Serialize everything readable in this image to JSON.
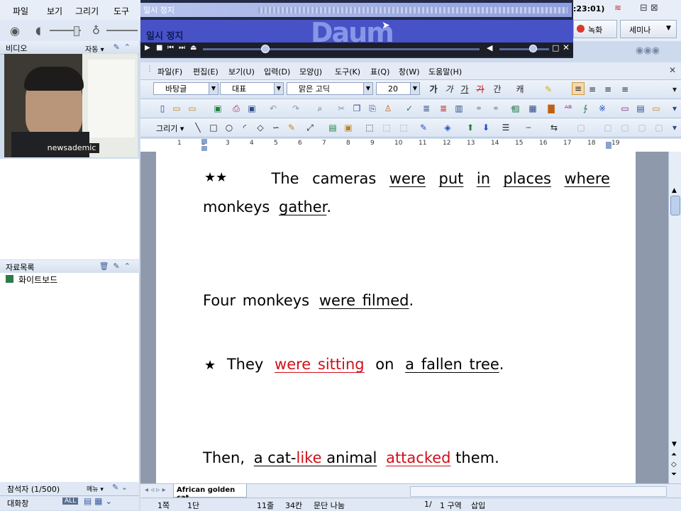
{
  "app": {
    "menu": [
      "파일",
      "보기",
      "그리기",
      "도구"
    ],
    "clock": ":23:01)",
    "record_button": "녹화",
    "seminar_button": "세미나",
    "video_panel": {
      "title": "비디오",
      "mode": "자동 ▾"
    },
    "presenter_name": "newsademic",
    "materials_panel": {
      "title": "자료목록",
      "items": [
        "화이트보드"
      ]
    },
    "participants_panel": {
      "title": "참석자 (1/500)",
      "menu_label": "메뉴 ▾"
    },
    "chat_panel": {
      "title": "대화창",
      "all_badge": "ALL"
    }
  },
  "player": {
    "top_text": "일시 정지",
    "status_text": "일시 정지",
    "logo": "Daum"
  },
  "wp": {
    "menu": [
      "파일(F)",
      "편집(E)",
      "보기(U)",
      "입력(D)",
      "모양(J)",
      "도구(K)",
      "표(Q)",
      "창(W)",
      "도움말(H)"
    ],
    "style_combo": "바탕글",
    "lang_combo": "대표",
    "font_combo": "맑은 고딕",
    "size_combo": "20",
    "draw_label": "그리기 ▾",
    "ruler_numbers": [
      "1",
      "2",
      "3",
      "4",
      "5",
      "6",
      "7",
      "8",
      "9",
      "10",
      "11",
      "12",
      "13",
      "14",
      "15",
      "16",
      "17",
      "18",
      "19"
    ],
    "doc_tab": "African golden cat",
    "status": [
      "1쪽",
      "1단",
      "11줄",
      "34칸",
      "문단 나눔",
      "1/",
      "1 구역",
      "삽입"
    ]
  },
  "doc": {
    "l1": {
      "stars": "★★",
      "w": [
        "The",
        "cameras",
        "were",
        "put",
        "in",
        "places",
        "where"
      ]
    },
    "l2": {
      "a": "monkeys",
      "b": "gather",
      "c": "."
    },
    "l3": {
      "a": "Four monkeys",
      "b": "were filmed",
      "c": "."
    },
    "l4": {
      "star": "★",
      "a": "They",
      "b": "were sitting",
      "c": "on",
      "d": "a fallen tree",
      "e": "."
    },
    "l5": {
      "a": "Then,",
      "b1": "a cat-",
      "b2": "like",
      "b3": " animal",
      "c": "attacked",
      "d": " them."
    }
  },
  "colors": {
    "accent_red": "#d0101a",
    "player_blue": "#4652c6"
  }
}
